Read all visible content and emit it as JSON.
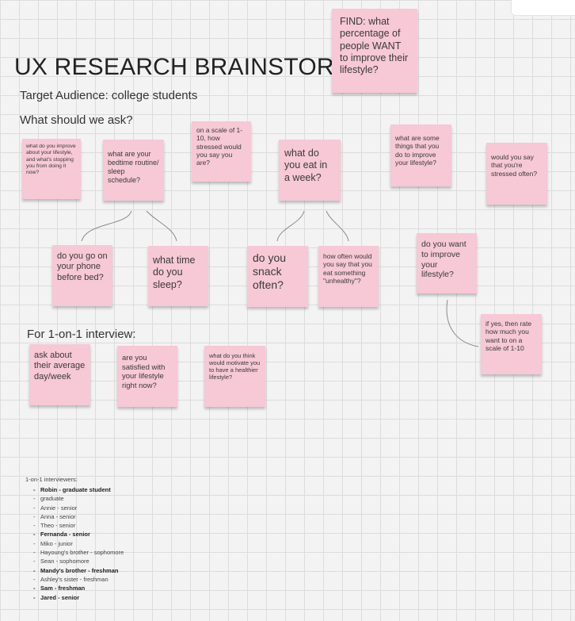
{
  "board": {
    "title": "UX RESEARCH BRAINSTORM",
    "target_audience": "Target Audience: college students",
    "questions_heading": "What should we ask?",
    "interview_heading": "For 1-on-1 interview:"
  },
  "notes": {
    "find": "FIND: what percentage of people WANT to improve their lifestyle?",
    "improve_lifestyle": "what do you improve about your lifestyle, and what's stopping you from doing it now?",
    "bedtime_routine": "what are your bedtime routine/ sleep schedule?",
    "stress_scale": "on a scale of 1-10, how stressed would you say you are?",
    "eat_week": "what do you eat in a week?",
    "things_to_improve": "what are some things that you do to improve your lifestyle?",
    "stressed_often": "would you say that you're stressed often?",
    "phone_before_bed": "do you go on your phone before bed?",
    "sleep_time": "what time do you sleep?",
    "snack_often": "do you snack often?",
    "unhealthy_often": "how often would you say that you eat something \"unhealthy\"?",
    "want_improve": "do you want to improve your lifestyle?",
    "rate_want": "if yes, then rate how much you want to on a scale of 1-10",
    "average_day": "ask about their average day/week",
    "satisfied": "are you satisfied with your lifestyle right now?",
    "motivate": "what do you think would motivate you to have a healthier lifestyle?"
  },
  "interviewers": {
    "label": "1-on-1 interviewers:",
    "items": [
      {
        "text": "Robin - graduate student",
        "bold": true
      },
      {
        "text": "graduate",
        "bold": false
      },
      {
        "text": "Annie - senior",
        "bold": false
      },
      {
        "text": "Anna - senior",
        "bold": false
      },
      {
        "text": "Theo - senior",
        "bold": false
      },
      {
        "text": "Fernanda - senior",
        "bold": true
      },
      {
        "text": "Miko - junior",
        "bold": false
      },
      {
        "text": "Hayoung's brother - sophomore",
        "bold": false
      },
      {
        "text": "Sean - sophomore",
        "bold": false
      },
      {
        "text": "Mandy's brother - freshman",
        "bold": true
      },
      {
        "text": "Ashley's sister - freshman",
        "bold": false
      },
      {
        "text": "Sam - freshman",
        "bold": true
      },
      {
        "text": "Jared - senior",
        "bold": true
      }
    ]
  },
  "colors": {
    "sticky": "#f7c8d6",
    "connector": "#8a8a8a"
  }
}
